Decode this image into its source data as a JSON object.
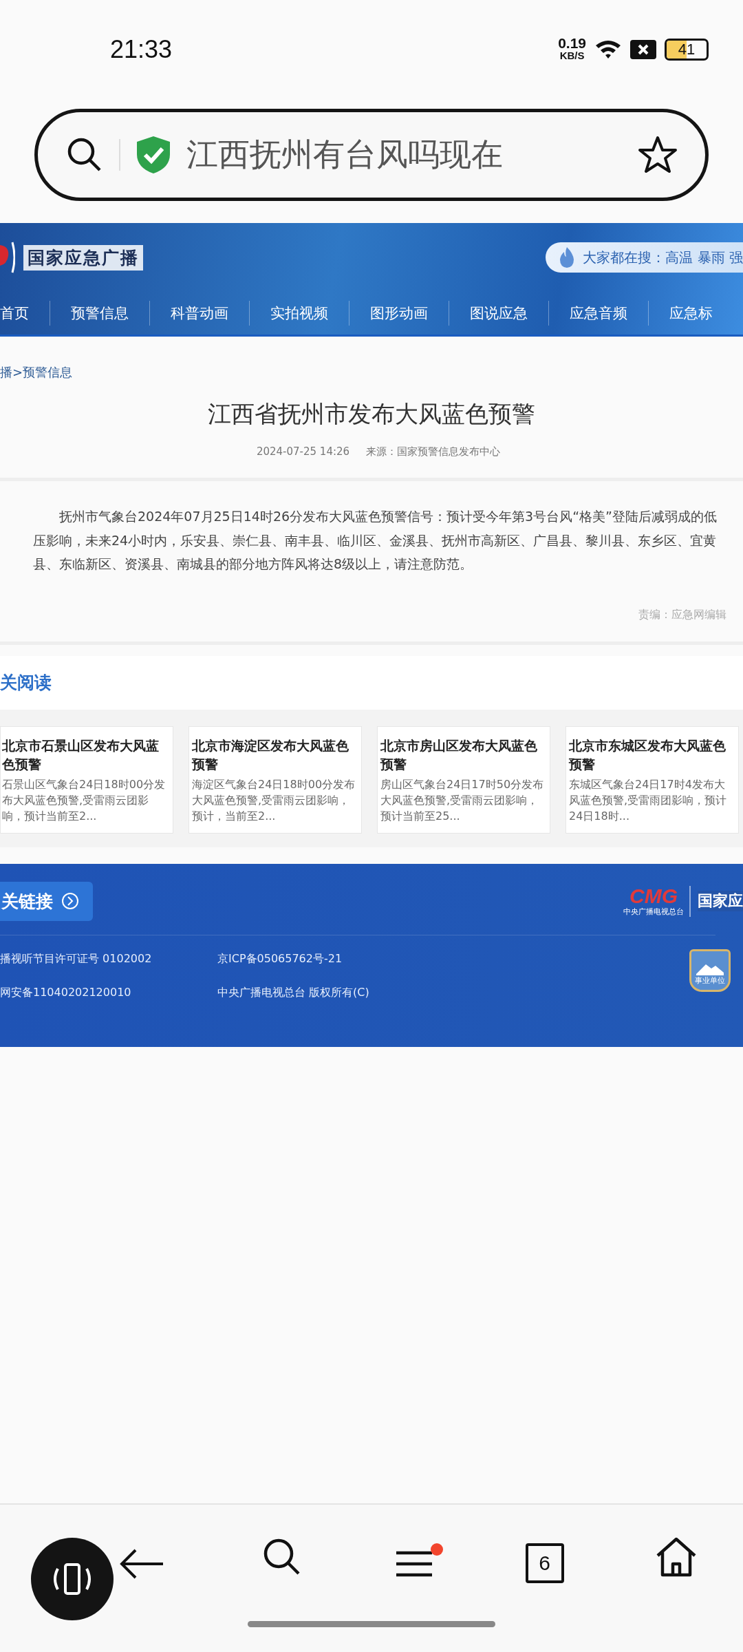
{
  "status_bar": {
    "time": "21:33",
    "net_speed": "0.19",
    "net_unit": "KB/S",
    "battery": "41"
  },
  "address_bar": {
    "query": "江西抚州有台风吗现在"
  },
  "site_header": {
    "site_name": "国家应急广播",
    "hot_search": "大家都在搜：高温 暴雨 强",
    "nav": [
      {
        "label": "首页",
        "selected": false
      },
      {
        "label": "预警信息",
        "selected": false
      },
      {
        "label": "科普动画",
        "selected": false
      },
      {
        "label": "实拍视频",
        "selected": false
      },
      {
        "label": "图形动画",
        "selected": false
      },
      {
        "label": "图说应急",
        "selected": false
      },
      {
        "label": "应急音频",
        "selected": false
      },
      {
        "label": "应急标",
        "selected": false
      }
    ]
  },
  "breadcrumb": "播>预警信息",
  "article": {
    "title": "江西省抚州市发布大风蓝色预警",
    "date": "2024-07-25 14:26",
    "source": "来源：国家预警信息发布中心",
    "body": "抚州市气象台2024年07月25日14时26分发布大风蓝色预警信号：预计受今年第3号台风“格美”登陆后减弱成的低压影响，未来24小时内，乐安县、崇仁县、南丰县、临川区、金溪县、抚州市高新区、广昌县、黎川县、东乡区、宜黄县、东临新区、资溪县、南城县的部分地方阵风将达8级以上，请注意防范。",
    "editor": "责编：应急网编辑"
  },
  "related": {
    "heading": "关阅读",
    "cards": [
      {
        "title": "北京市石景山区发布大风蓝色预警",
        "summary": "石景山区气象台24日18时00分发布大风蓝色预警,受雷雨云团影响，预计当前至2..."
      },
      {
        "title": "北京市海淀区发布大风蓝色预警",
        "summary": "海淀区气象台24日18时00分发布大风蓝色预警,受雷雨云团影响，预计，当前至2..."
      },
      {
        "title": "北京市房山区发布大风蓝色预警",
        "summary": "房山区气象台24日17时50分发布大风蓝色预警,受雷雨云团影响，预计当前至25..."
      },
      {
        "title": "北京市东城区发布大风蓝色预警",
        "summary": "东城区气象台24日17时4发布大风蓝色预警,受雷雨团影响，预计24日18时..."
      }
    ]
  },
  "footer": {
    "links_button": "关链接",
    "lines": [
      "播视听节目许可证号 0102002",
      "京ICP备05065762号-21",
      "网安备11040202120010",
      "中央广播电视总台 版权所有(C)"
    ],
    "logo_text": "CMG",
    "logo_subtext": "中央广播电视总台",
    "org_name": "国家应",
    "badge_text": "事业单位"
  },
  "bottom_bar": {
    "tab_count": "6",
    "menu_notification": true
  }
}
